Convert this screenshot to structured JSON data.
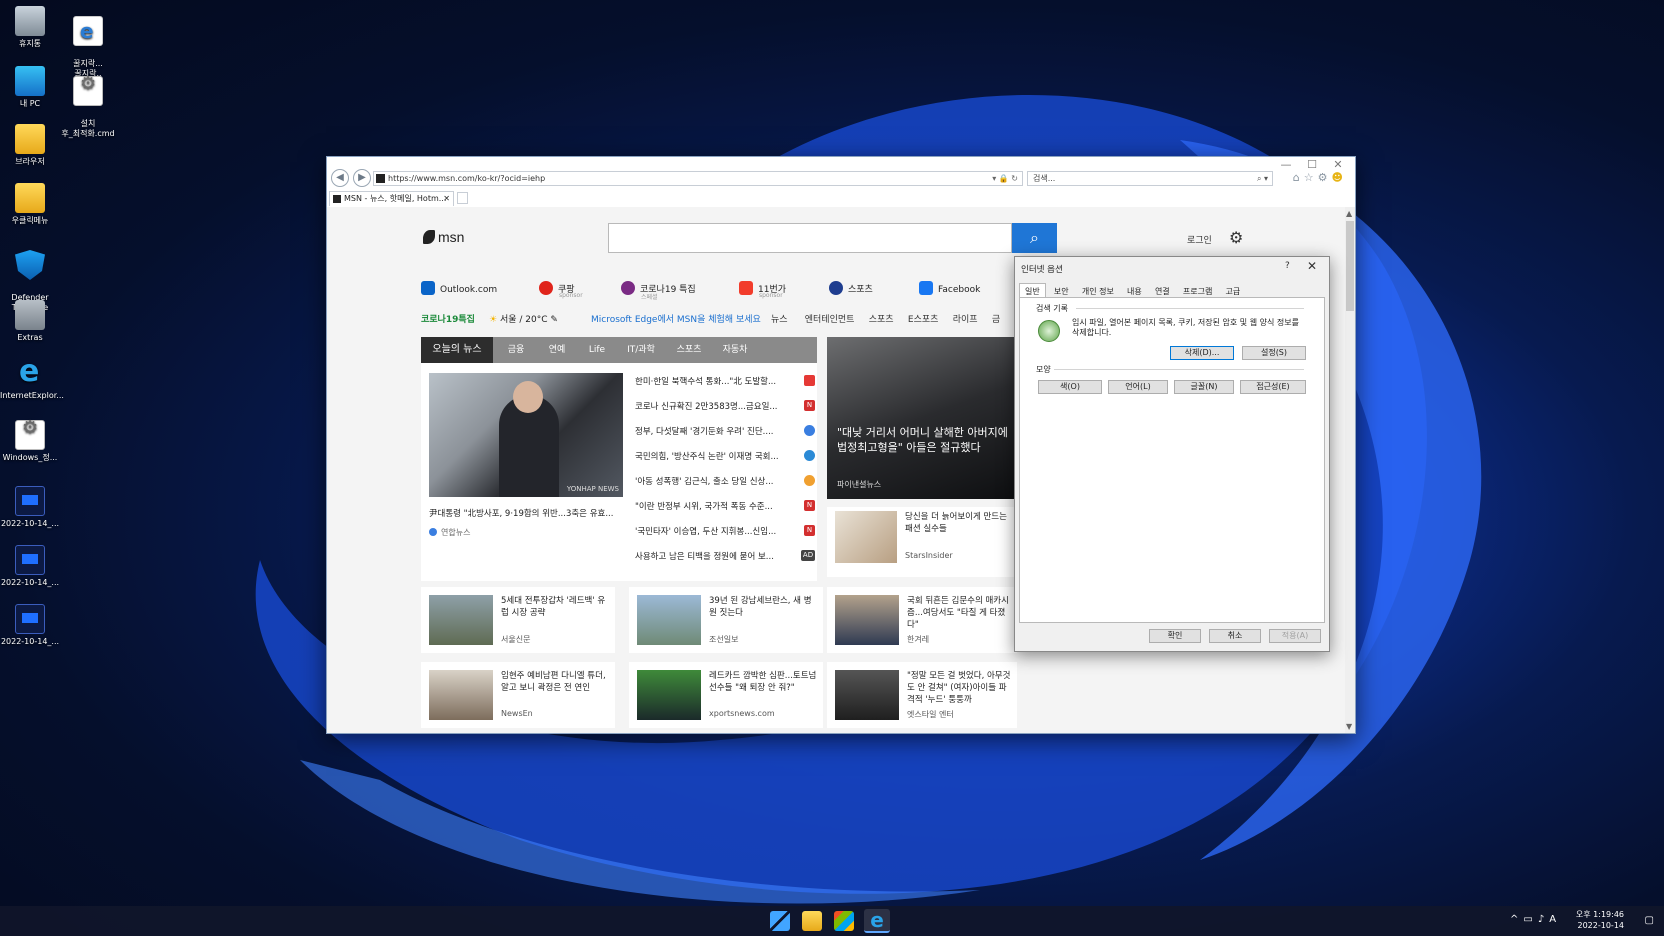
{
  "desktop": {
    "icons": [
      {
        "label": "휴지통",
        "icon": "recycle-bin-icon"
      },
      {
        "label": "꿀지락...\n꿀지락..",
        "icon": "html-file-icon"
      },
      {
        "label": "내 PC",
        "icon": "pc-icon"
      },
      {
        "label": "설치\n후_최적화.cmd",
        "icon": "cmd-gear-icon"
      },
      {
        "label": "브라우저",
        "icon": "folder-icon"
      },
      {
        "label": "우클릭메뉴",
        "icon": "folder-icon"
      },
      {
        "label": "Defender\nTools.exe",
        "icon": "shield-icon"
      },
      {
        "label": "Extras",
        "icon": "extras-icon"
      },
      {
        "label": "InternetExplor...",
        "icon": "ie-icon"
      },
      {
        "label": "Windows_정...",
        "icon": "gear-file-icon"
      },
      {
        "label": "2022-10-14_...",
        "icon": "screenshot-icon"
      },
      {
        "label": "2022-10-14_...",
        "icon": "screenshot-icon"
      },
      {
        "label": "2022-10-14_...",
        "icon": "screenshot-icon"
      }
    ]
  },
  "browser": {
    "address": "https://www.msn.com/ko-kr/?ocid=iehp",
    "search_placeholder": "검색...",
    "tab_title": "MSN - 뉴스, 핫메일, Hotm...",
    "window_controls": {
      "min": "—",
      "max": "☐",
      "close": "✕"
    }
  },
  "msn": {
    "logo": "msn",
    "login": "로그인",
    "quick_links": [
      {
        "label": "Outlook.com",
        "sub": "",
        "color": "#0a64c8"
      },
      {
        "label": "쿠팡",
        "sub": "sponsor",
        "color": "#e0241b"
      },
      {
        "label": "코로나19 특집",
        "sub": "스페셜",
        "color": "#7a2b84"
      },
      {
        "label": "11번가",
        "sub": "sponsor",
        "color": "#f23c2b"
      },
      {
        "label": "스포츠",
        "sub": "",
        "color": "#1e3d8f"
      },
      {
        "label": "Facebook",
        "sub": "",
        "color": "#1877f2"
      }
    ],
    "bar": {
      "covid": "코로나19특집",
      "weather": "서울 / 20°C",
      "edge": "Microsoft Edge에서 MSN을 체험해 보세요",
      "nav": [
        "뉴스",
        "엔터테인먼트",
        "스포츠",
        "E스포츠",
        "라이프",
        "금"
      ]
    },
    "news_tabs": [
      "오늘의 뉴스",
      "금융",
      "연예",
      "Life",
      "IT/과학",
      "스포츠",
      "자동차"
    ],
    "lead": {
      "caption": "尹대통령 \"北방사포, 9·19합의 위반...3축은 유효...",
      "source": "연합뉴스",
      "watermark": "YONHAP NEWS"
    },
    "headlines": [
      {
        "text": "한미·한일 북핵수석 통화...\"北 도발할...",
        "badge_color": "#e53935",
        "badge": ""
      },
      {
        "text": "코로나 신규확진 2만3583명...금요일...",
        "badge_color": "#d32f2f",
        "badge": "N"
      },
      {
        "text": "정부, 다섯달째 '경기둔화 우려' 진단....",
        "badge_color": "#3a7ee0",
        "badge": ""
      },
      {
        "text": "국민의힘, '방산주식 논란' 이재명 국회...",
        "badge_color": "#2b8ad6",
        "badge": ""
      },
      {
        "text": "'아동 성폭행' 김근식, 출소 당일 신상...",
        "badge_color": "#f0a030",
        "badge": ""
      },
      {
        "text": "\"이란 반정부 시위, 국가적 폭동 수준...",
        "badge_color": "#d32f2f",
        "badge": "N"
      },
      {
        "text": "'국민타자' 이승엽, 두산 지휘봉...신임...",
        "badge_color": "#d32f2f",
        "badge": "N"
      },
      {
        "text": "사용하고 남은 티백을 정원에 묻어 보...",
        "badge_color": "#444444",
        "badge": "AD"
      }
    ],
    "feature": {
      "text": "\"대낮 거리서 어머니 살해한 아버지에 법정최고형을\" 아들은 절규했다",
      "source": "파이낸셜뉴스"
    },
    "card_side": {
      "text": "당신을 더 늙어보이게 만드는 패션 실수들",
      "source": "StarsInsider"
    },
    "cards": [
      {
        "text": "5세대 전투장갑차 '레드백' 유럽 시장 공략",
        "source": "서울신문"
      },
      {
        "text": "39년 된 강남세브란스, 새 병원 짓는다",
        "source": "조선일보"
      },
      {
        "text": "국회 뒤흔든 김문수의 매카시즘...여당서도 \"타질 게 타졌다\"",
        "source": "한겨레"
      },
      {
        "text": "임현주 예비남편 다니엘 튜더, 알고 보니 곽정은 전 연인",
        "source": "NewsEn"
      },
      {
        "text": "레드카드 깜박한 심판...토트넘 선수들 \"왜 퇴장 안 줘?\"",
        "source": "xportsnews.com"
      },
      {
        "text": "\"정말 모든 걸 벗었다, 아무것도 안 걸쳐\" (여자)아이들 파격적 '누드' 퉁퉁까",
        "source": "엣스타일 엔터"
      }
    ]
  },
  "dialog": {
    "title": "인터넷 옵션",
    "help": "?",
    "close": "✕",
    "tabs": [
      "일반",
      "보안",
      "개인 정보",
      "내용",
      "연결",
      "프로그램",
      "고급"
    ],
    "history_group": "검색 기록",
    "history_text": "임시 파일, 열어본 페이지 목록, 쿠키, 저장된 암호 및 웹 양식 정보를 삭제합니다.",
    "delete_btn": "삭제(D)...",
    "settings_btn": "설정(S)",
    "appearance_group": "모양",
    "color_btn": "색(O)",
    "lang_btn": "언어(L)",
    "font_btn": "글꼴(N)",
    "access_btn": "접근성(E)",
    "ok_btn": "확인",
    "cancel_btn": "취소",
    "apply_btn": "적용(A)"
  },
  "taskbar": {
    "time": "오후 1:19:46",
    "date": "2022-10-14",
    "ime": "A"
  }
}
